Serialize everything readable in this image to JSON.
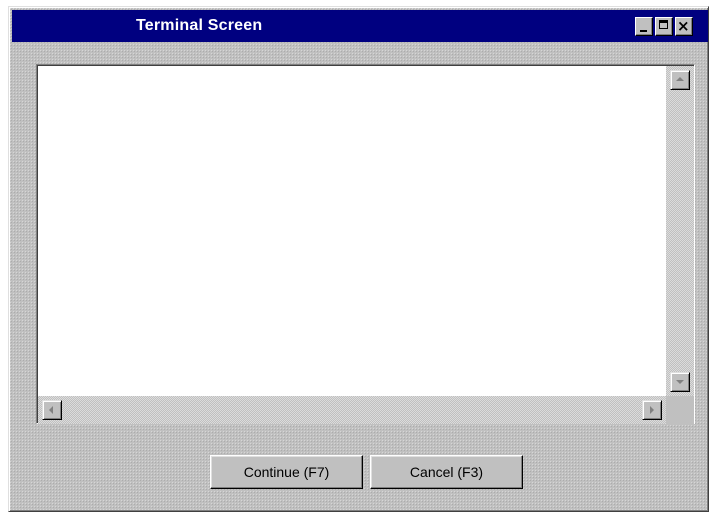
{
  "window": {
    "title": "Terminal Screen",
    "titlebar_color": "#000080",
    "face_color": "#c0c0c0",
    "controls": {
      "minimize_icon": "minimize-icon",
      "maximize_icon": "maximize-icon",
      "close_icon": "close-icon",
      "close_glyph": "×"
    }
  },
  "terminal": {
    "content": ""
  },
  "buttons": {
    "continue_label": "Continue (F7)",
    "cancel_label": "Cancel (F3)"
  }
}
